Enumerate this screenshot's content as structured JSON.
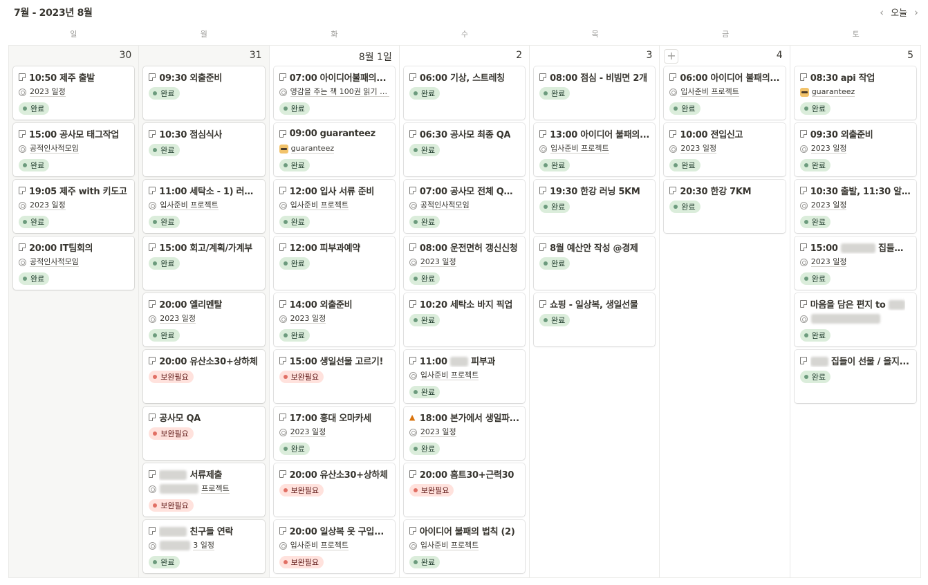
{
  "header": {
    "title": "7월 - 2023년 8월",
    "prev_icon": "chevron-left-icon",
    "today_label": "오늘",
    "next_icon": "chevron-right-icon"
  },
  "weekdays": [
    "일",
    "월",
    "화",
    "수",
    "목",
    "금",
    "토"
  ],
  "colors": {
    "done_bg": "#dbeddb",
    "done_dot": "#6c9b7d",
    "need_bg": "#ffe2dd",
    "need_dot": "#e16f64"
  },
  "days": [
    {
      "date": "30",
      "past": true,
      "cards": [
        {
          "title": "10:50 제주 출발",
          "relation": "2023 일정",
          "status": "완료"
        },
        {
          "title": "15:00 공사모 태그작업",
          "relation": "공적인사적모임",
          "status": "완료"
        },
        {
          "title": "19:05 제주 with 키도고",
          "relation": "2023 일정",
          "status": "완료"
        },
        {
          "title": "20:00 IT팀회의",
          "relation": "공적인사적모임",
          "status": "완료"
        }
      ]
    },
    {
      "date": "31",
      "past": true,
      "cards": [
        {
          "title": "09:30 외출준비",
          "status": "완료"
        },
        {
          "title": "10:30 점심식사",
          "status": "완료"
        },
        {
          "title": "11:00 세탁소 - 1) 러그 ...",
          "relation": "입사준비 프로젝트",
          "status": "완료"
        },
        {
          "title": "15:00 회고/계획/가계부",
          "status": "완료"
        },
        {
          "title": "20:00 엘리멘탈",
          "relation": "2023 일정",
          "status": "완료"
        },
        {
          "title": "20:00 유산소30+상하체",
          "status": "보완필요",
          "status_type": "need"
        },
        {
          "title": "공사모 QA",
          "status": "보완필요",
          "status_type": "need"
        },
        {
          "title": "서류제출",
          "blur_title": 40,
          "relation": "프로젝트",
          "blur_relation": 56,
          "status": "보완필요",
          "status_type": "need"
        },
        {
          "title": "친구들 연락",
          "blur_title": 40,
          "relation": "3 일정",
          "blur_relation": 44,
          "status": "완료"
        }
      ]
    },
    {
      "date": "8월 1일",
      "cards": [
        {
          "title": "07:00 아이디어불패의...",
          "relation": "영감을 주는 책 100권 읽기 (주 1",
          "status": "완료"
        },
        {
          "title": "09:00 guaranteez",
          "relation": "guaranteez",
          "relation_icon": "avatar",
          "status": "완료"
        },
        {
          "title": "12:00 입사 서류 준비",
          "relation": "입사준비 프로젝트",
          "status": "완료"
        },
        {
          "title": "12:00 피부과예약",
          "status": "완료"
        },
        {
          "title": "14:00 외출준비",
          "relation": "2023 일정",
          "status": "완료"
        },
        {
          "title": "15:00 생일선물 고르기!",
          "status": "보완필요",
          "status_type": "need"
        },
        {
          "title": "17:00 홍대 오마카세",
          "relation": "2023 일정",
          "status": "완료"
        },
        {
          "title": "20:00 유산소30+상하체",
          "status": "보완필요",
          "status_type": "need"
        },
        {
          "title": "20:00 일상복 옷 구입...",
          "relation": "입사준비 프로젝트",
          "status": "보완필요",
          "status_type": "need"
        }
      ]
    },
    {
      "date": "2",
      "cards": [
        {
          "title": "06:00 기상, 스트레칭",
          "status": "완료"
        },
        {
          "title": "06:30 공사모 최종 QA",
          "status": "완료"
        },
        {
          "title": "07:00 공사모 전체 QA...",
          "relation": "공적인사적모임",
          "status": "완료"
        },
        {
          "title": "08:00 운전면허 갱신신청",
          "relation": "2023 일정",
          "status": "완료"
        },
        {
          "title": "10:20 세탁소 바지 픽업",
          "status": "완료"
        },
        {
          "title": "11:00 피부과",
          "blur_mid": 26,
          "title_prefix": "11:00",
          "title_suffix": "피부과",
          "relation": "입사준비 프로젝트",
          "status": "완료"
        },
        {
          "title": "18:00 본가에서 생일파...",
          "title_icon": "cake",
          "relation": "2023 일정",
          "status": "완료"
        },
        {
          "title": "20:00 홈트30+근력30",
          "status": "보완필요",
          "status_type": "need"
        },
        {
          "title": "아이디어 불패의 법칙 (2)",
          "relation": "입사준비 프로젝트",
          "status": "완료"
        }
      ]
    },
    {
      "date": "3",
      "cards": [
        {
          "title": "08:00 점심 - 비빔면 2개",
          "status": "완료"
        },
        {
          "title": "13:00 아이디어 불패의...",
          "relation": "입사준비 프로젝트",
          "status": "완료"
        },
        {
          "title": "19:30 한강 러닝 5KM",
          "status": "완료"
        },
        {
          "title": "8월 예산안 작성 @경제",
          "status": "완료"
        },
        {
          "title": "쇼핑 - 일상복, 생일선물",
          "status": "완료"
        }
      ]
    },
    {
      "date": "4",
      "has_add": true,
      "add_icon": "plus-icon",
      "cards": [
        {
          "title": "06:00 아이디어 불패의...",
          "relation": "입사준비 프로젝트",
          "status": "완료"
        },
        {
          "title": "10:00 전입신고",
          "relation": "2023 일정",
          "status": "완료"
        },
        {
          "title": "20:30 한강 7KM",
          "status": "완료"
        }
      ]
    },
    {
      "date": "5",
      "cards": [
        {
          "title": "08:30 api 작업",
          "relation": "guaranteez",
          "relation_icon": "avatar",
          "status": "완료",
          "no_target": true
        },
        {
          "title": "09:30 외출준비",
          "relation": "2023 일정",
          "status": "완료"
        },
        {
          "title": "10:30 출발, 11:30 알...",
          "relation": "2023 일정",
          "status": "완료"
        },
        {
          "title": "15:00 집들이...",
          "blur_mid": 50,
          "title_prefix": "15:00",
          "title_suffix": "집들이...",
          "relation": "2023 일정",
          "status": "완료"
        },
        {
          "title": "마음을 담은 편지 to",
          "blur_after": 24,
          "relation": "",
          "blur_relation": 100,
          "status": "완료"
        },
        {
          "title": "집들이 선물 / 을지...",
          "blur_title": 26,
          "status": "완료"
        }
      ]
    }
  ]
}
